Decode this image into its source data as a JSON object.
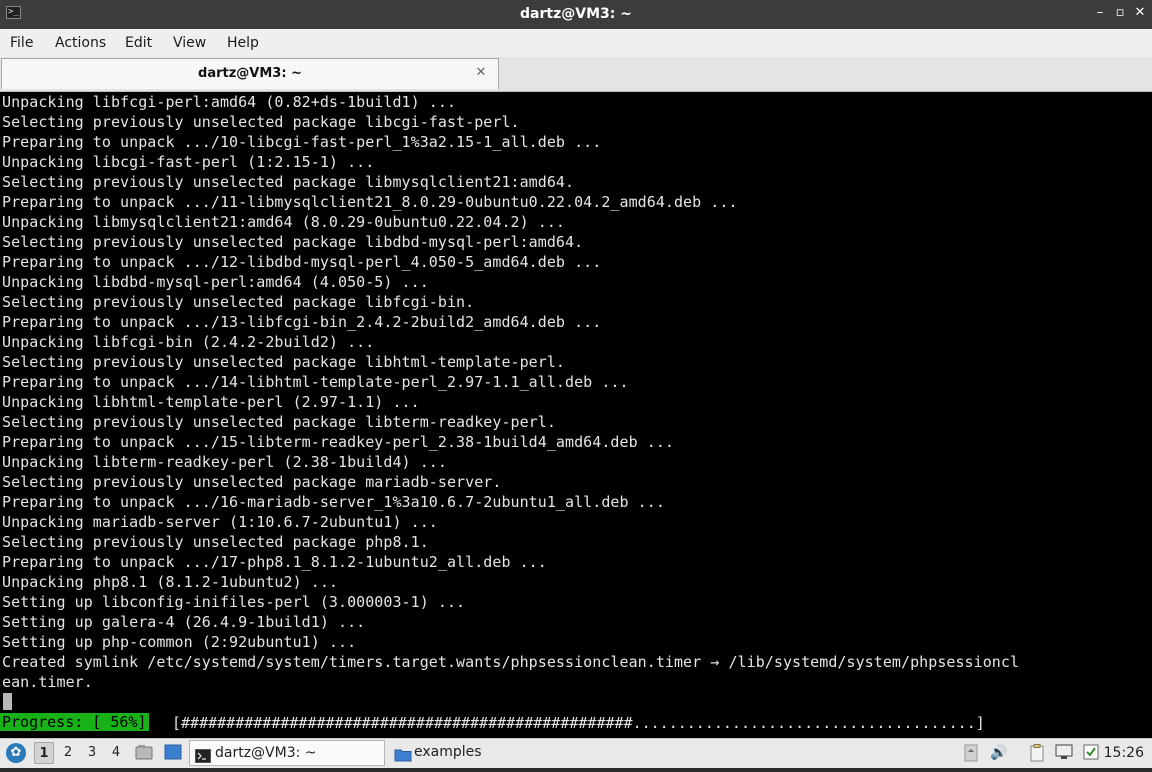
{
  "window": {
    "title": "dartz@VM3: ~",
    "minimize_glyph": "–",
    "restore_glyph": "▫",
    "maximize_glyph": "□",
    "close_glyph": "✕"
  },
  "menubar": {
    "file": "File",
    "actions": "Actions",
    "edit": "Edit",
    "view": "View",
    "help": "Help"
  },
  "tab": {
    "label": "dartz@VM3: ~",
    "close_glyph": "✕"
  },
  "terminal": {
    "lines": [
      "Unpacking libfcgi-perl:amd64 (0.82+ds-1build1) ...",
      "Selecting previously unselected package libcgi-fast-perl.",
      "Preparing to unpack .../10-libcgi-fast-perl_1%3a2.15-1_all.deb ...",
      "Unpacking libcgi-fast-perl (1:2.15-1) ...",
      "Selecting previously unselected package libmysqlclient21:amd64.",
      "Preparing to unpack .../11-libmysqlclient21_8.0.29-0ubuntu0.22.04.2_amd64.deb ...",
      "Unpacking libmysqlclient21:amd64 (8.0.29-0ubuntu0.22.04.2) ...",
      "Selecting previously unselected package libdbd-mysql-perl:amd64.",
      "Preparing to unpack .../12-libdbd-mysql-perl_4.050-5_amd64.deb ...",
      "Unpacking libdbd-mysql-perl:amd64 (4.050-5) ...",
      "Selecting previously unselected package libfcgi-bin.",
      "Preparing to unpack .../13-libfcgi-bin_2.4.2-2build2_amd64.deb ...",
      "Unpacking libfcgi-bin (2.4.2-2build2) ...",
      "Selecting previously unselected package libhtml-template-perl.",
      "Preparing to unpack .../14-libhtml-template-perl_2.97-1.1_all.deb ...",
      "Unpacking libhtml-template-perl (2.97-1.1) ...",
      "Selecting previously unselected package libterm-readkey-perl.",
      "Preparing to unpack .../15-libterm-readkey-perl_2.38-1build4_amd64.deb ...",
      "Unpacking libterm-readkey-perl (2.38-1build4) ...",
      "Selecting previously unselected package mariadb-server.",
      "Preparing to unpack .../16-mariadb-server_1%3a10.6.7-2ubuntu1_all.deb ...",
      "Unpacking mariadb-server (1:10.6.7-2ubuntu1) ...",
      "Selecting previously unselected package php8.1.",
      "Preparing to unpack .../17-php8.1_8.1.2-1ubuntu2_all.deb ...",
      "Unpacking php8.1 (8.1.2-1ubuntu2) ...",
      "Setting up libconfig-inifiles-perl (3.000003-1) ...",
      "Setting up galera-4 (26.4.9-1build1) ...",
      "Setting up php-common (2:92ubuntu1) ...",
      "Created symlink /etc/systemd/system/timers.target.wants/phpsessionclean.timer → /lib/systemd/system/phpsessioncl",
      "ean.timer."
    ],
    "progress_label": "Progress: [ 56%]",
    "progress_percent": 56,
    "progress_bar": "[##################################################......................................]"
  },
  "taskbar": {
    "start_glyph": "✿",
    "workspaces": [
      "1",
      "2",
      "3",
      "4"
    ],
    "active_workspace": "1",
    "tasks": [
      {
        "label": "dartz@VM3: ~",
        "icon": "terminal-icon",
        "active": true
      },
      {
        "label": "examples",
        "icon": "folder-icon",
        "active": false
      }
    ],
    "volume_glyph": "🔊",
    "clock": "15:26"
  },
  "colors": {
    "terminal_bg": "#000000",
    "terminal_fg": "#e5e5e5",
    "progress_bg": "#18b218",
    "titlebar_bg": "#3c3c3c"
  }
}
